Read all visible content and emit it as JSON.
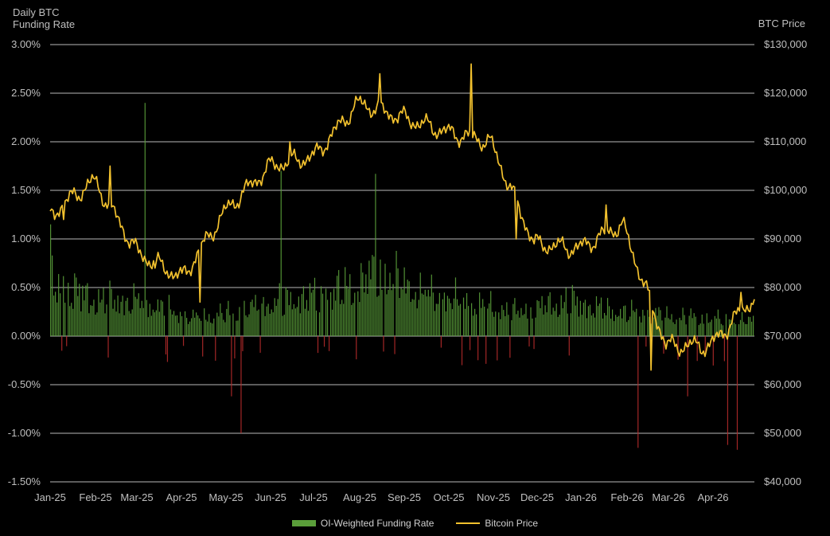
{
  "chart_data": {
    "type": "bar+line",
    "left_axis_title": [
      "Daily BTC",
      "Funding Rate"
    ],
    "right_axis_title": "BTC Price",
    "left_ticks": [
      "3.00%",
      "2.50%",
      "2.00%",
      "1.50%",
      "1.00%",
      "0.50%",
      "0.00%",
      "-0.50%",
      "-1.00%",
      "-1.50%"
    ],
    "left_range": [
      -1.5,
      3.0
    ],
    "right_ticks": [
      "$130,000",
      "$120,000",
      "$110,000",
      "$100,000",
      "$90,000",
      "$80,000",
      "$70,000",
      "$60,000",
      "$50,000",
      "$40,000"
    ],
    "right_range": [
      40000,
      130000
    ],
    "x_ticks": [
      "Jan-25",
      "Feb-25",
      "Mar-25",
      "Apr-25",
      "May-25",
      "Jun-25",
      "Jul-25",
      "Aug-25",
      "Sep-25",
      "Oct-25",
      "Nov-25",
      "Dec-25",
      "Jan-26",
      "Feb-26",
      "Mar-26",
      "Apr-26"
    ],
    "grid": "horizontal",
    "colors": {
      "positive_bar": "#5a9e3a",
      "negative_bar": "#b22a2a",
      "price_line": "#f2c12e",
      "grid": "#d9d9d9"
    },
    "series": [
      {
        "name": "OI-Weighted Funding Rate",
        "kind": "bar",
        "unit": "%",
        "monthly_points": [
          0.9,
          0.62,
          0.58,
          0.3,
          0.42,
          0.6,
          0.72,
          1.05,
          0.7,
          0.55,
          0.4,
          0.6,
          0.42,
          0.35,
          0.3,
          0.25
        ],
        "notable_values": [
          {
            "date": "Jan-25",
            "value": 1.15
          },
          {
            "date": "Mar-25",
            "value": 2.4
          },
          {
            "date": "May-25",
            "value": -1.0
          },
          {
            "date": "May-25",
            "value": -0.62
          },
          {
            "date": "Jun-25",
            "value": 1.7
          },
          {
            "date": "Aug-25",
            "value": 1.67
          },
          {
            "date": "Feb-26",
            "value": -1.15
          },
          {
            "date": "Mar-26",
            "value": -0.62
          },
          {
            "date": "Apr-26",
            "value": -1.17
          },
          {
            "date": "Apr-26",
            "value": -1.12
          }
        ]
      },
      {
        "name": "Bitcoin Price",
        "kind": "line",
        "unit": "USD",
        "monthly_points": [
          95000,
          102000,
          87000,
          82000,
          96000,
          105000,
          107000,
          118000,
          115000,
          112000,
          110000,
          89000,
          88000,
          93000,
          68000,
          68000,
          78000
        ],
        "notable_values": [
          {
            "date": "Jan-25",
            "value": 94000
          },
          {
            "date": "Feb-25",
            "value": 105000
          },
          {
            "date": "Mar-25",
            "value": 84000
          },
          {
            "date": "Apr-25",
            "value": 77000
          },
          {
            "date": "Jun-25",
            "value": 110000
          },
          {
            "date": "Aug-25",
            "value": 124000
          },
          {
            "date": "Oct-25",
            "value": 126000
          },
          {
            "date": "Nov-25",
            "value": 90000
          },
          {
            "date": "Jan-26",
            "value": 97000
          },
          {
            "date": "Feb-26",
            "value": 63000
          },
          {
            "date": "Apr-26",
            "value": 79000
          }
        ]
      }
    ]
  }
}
